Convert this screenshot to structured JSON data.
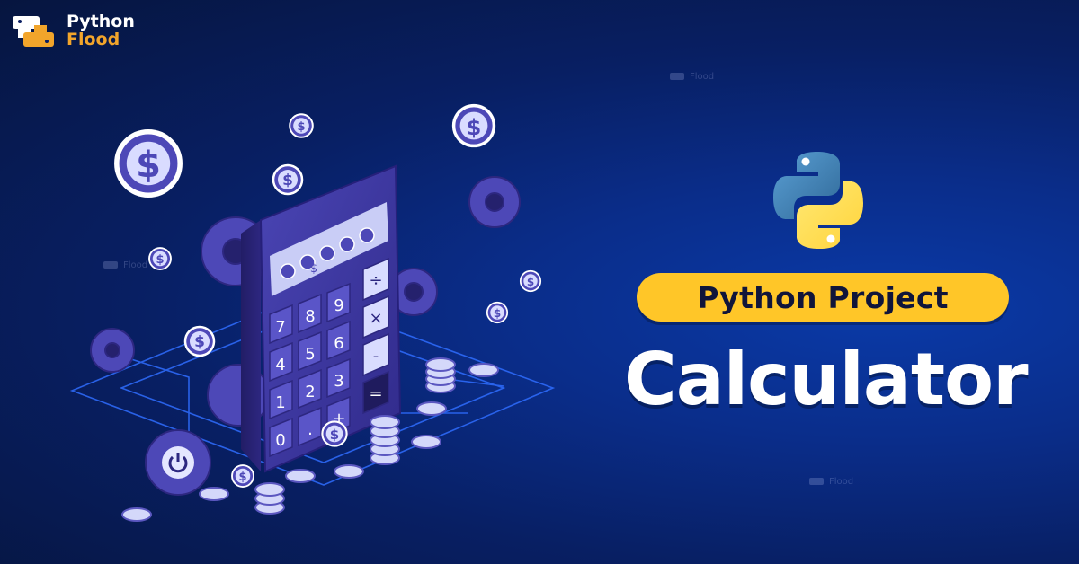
{
  "brand": {
    "name_line1": "Python",
    "name_line2": "Flood",
    "primary_color": "#ffffff",
    "accent_color": "#f2a52b"
  },
  "watermark": "Flood",
  "headline": {
    "badge_text": "Python Project",
    "title": "Calculator",
    "badge_color": "#ffc628"
  },
  "calculator": {
    "display_symbols": [
      "$",
      "$",
      "$",
      "$",
      "$"
    ],
    "keys": [
      "$",
      "$",
      "$",
      "÷",
      "9",
      "8",
      "7",
      "×",
      "6",
      "5",
      "4",
      "-",
      "3",
      "2",
      "1",
      "=",
      "+",
      ".",
      "0"
    ]
  },
  "icons": [
    "python-logo-icon",
    "dollar-coin-icon",
    "gear-icon",
    "power-icon",
    "calculator-icon"
  ]
}
